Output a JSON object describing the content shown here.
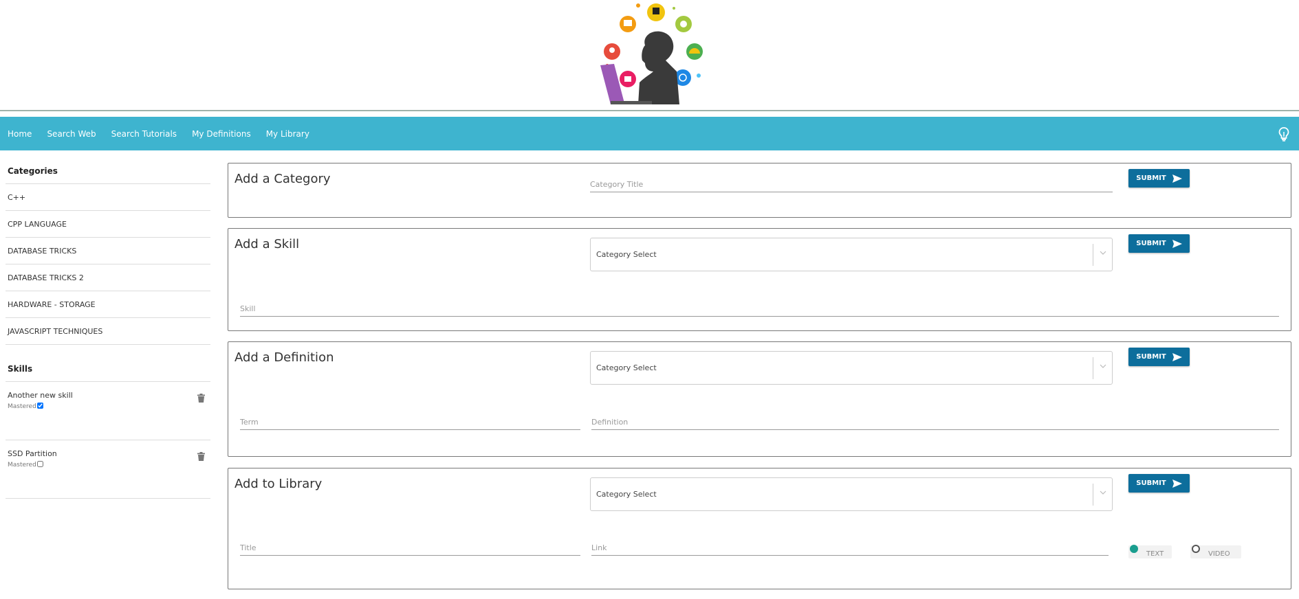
{
  "nav": {
    "items": [
      "Home",
      "Search Web",
      "Search Tutorials",
      "My Definitions",
      "My Library"
    ]
  },
  "sidebar": {
    "categories_heading": "Categories",
    "categories": [
      "C++",
      "CPP LANGUAGE",
      "DATABASE TRICKS",
      "DATABASE TRICKS 2",
      "HARDWARE - STORAGE",
      "JAVASCRIPT TECHNIQUES"
    ],
    "skills_heading": "Skills",
    "skills": [
      {
        "name": "Another new skill",
        "mastered_label": "Mastered",
        "mastered": true
      },
      {
        "name": "SSD Partition",
        "mastered_label": "Mastered",
        "mastered": false
      }
    ]
  },
  "cards": {
    "category": {
      "title": "Add a Category",
      "title_placeholder": "Category Title",
      "submit": "SUBMIT"
    },
    "skill": {
      "title": "Add a Skill",
      "select": "Category Select",
      "skill_placeholder": "Skill",
      "submit": "SUBMIT"
    },
    "definition": {
      "title": "Add a Definition",
      "select": "Category Select",
      "term_placeholder": "Term",
      "definition_placeholder": "Definition",
      "submit": "SUBMIT"
    },
    "library": {
      "title": "Add to Library",
      "select": "Category Select",
      "title_placeholder": "Title",
      "link_placeholder": "Link",
      "submit": "SUBMIT",
      "types": [
        {
          "label": "TEXT",
          "selected": true
        },
        {
          "label": "VIDEO",
          "selected": false
        }
      ]
    }
  },
  "colors": {
    "nav": "#3eb4cf",
    "button": "#0d6e9c",
    "radio_on": "#1a9e8f"
  },
  "icons": [
    "lightbulb-icon",
    "trash-icon",
    "send-icon",
    "chevron-down-icon",
    "logo-illustration"
  ]
}
